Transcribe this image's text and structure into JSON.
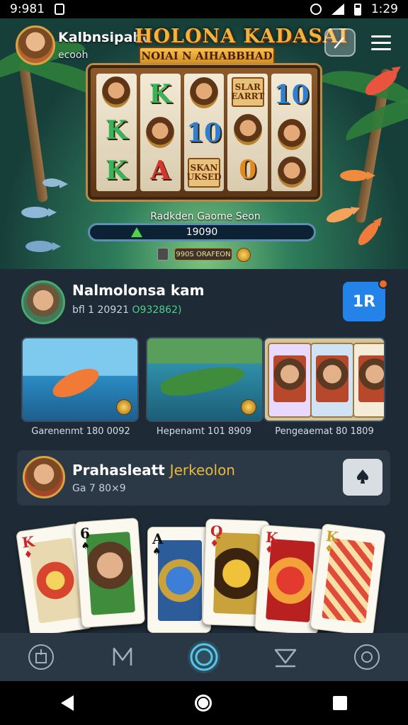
{
  "status_bar": {
    "time_left": "9:981",
    "time_right": "1:29"
  },
  "hero": {
    "profile_name": "Kalbnsipaho",
    "profile_sub": "ecooh",
    "game_title": "HOLONA KADASAI",
    "game_banner": "NOIAI N AIHABBHAD",
    "reels": [
      [
        "face",
        "K",
        "K"
      ],
      [
        "K",
        "face",
        "A"
      ],
      [
        "face",
        "10",
        "SKAN UKSED"
      ],
      [
        "SLAR EARRT",
        "face",
        "0"
      ],
      [
        "10",
        "face",
        "face"
      ]
    ],
    "progress_label": "Radkden Gaome Seon",
    "progress_value": "19090",
    "chip_text": "990S ORAFEON",
    "carousel": {
      "count": 3,
      "active": 0
    }
  },
  "account": {
    "name": "Nalmolonsa kam",
    "meta_prefix": "bfl 1 20921",
    "meta_highlight": "O932862)",
    "badge": "1R"
  },
  "tiles": [
    {
      "caption": "Garenenmt 180 0092"
    },
    {
      "caption": "Hepenamt 101 8909"
    },
    {
      "caption": "Pengeaemat 80 1809"
    }
  ],
  "jackpot": {
    "title_white": "Prahasleatt",
    "title_gold": "Jerkeolon",
    "sub": "Ga 7 80×9"
  },
  "cards": [
    {
      "rank": "K",
      "suit": "♦",
      "color": "#c8262b"
    },
    {
      "rank": "6",
      "suit": "♠",
      "color": "#111111"
    },
    {
      "rank": "A",
      "suit": "♠",
      "color": "#111111"
    },
    {
      "rank": "Q",
      "suit": "♦",
      "color": "#c8262b"
    },
    {
      "rank": "K",
      "suit": "♦",
      "color": "#c8262b"
    },
    {
      "rank": "K",
      "suit": "♦",
      "color": "#c8a02b"
    }
  ],
  "nav_icons": [
    "home-icon",
    "stats-icon",
    "spin-icon",
    "rewards-icon",
    "settings-icon"
  ],
  "colors": {
    "accent": "#2383e8",
    "gold": "#e9b93c",
    "green": "#4dd08a",
    "nav_active": "#53c7ec"
  }
}
